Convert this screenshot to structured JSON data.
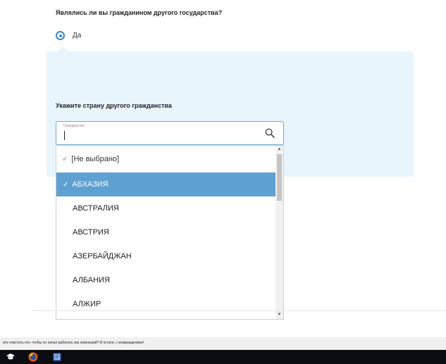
{
  "form": {
    "question": "Являлись ли вы гражданином другого государства?",
    "radio_option": "Да",
    "country_label": "Укажите страну другого гражданства",
    "input": {
      "caption": "Гражданство",
      "value": ""
    }
  },
  "dropdown": {
    "items": [
      {
        "label": "[Не выбрано]",
        "checked": true
      },
      {
        "label": "АБХАЗИЯ",
        "checked": true,
        "highlighted": true
      },
      {
        "label": "АВСТРАЛИЯ"
      },
      {
        "label": "АВСТРИЯ"
      },
      {
        "label": "АЗЕРБАЙДЖАН"
      },
      {
        "label": "АЛБАНИЯ"
      },
      {
        "label": "АЛЖИР"
      }
    ]
  },
  "notification": {
    "text": "ите очистить его, чтобы он начал работать как новенький? И кстати, с возвращением!"
  },
  "colors": {
    "accent": "#3a86c8",
    "panel_bg": "#e8f5fc",
    "selected_bg": "#5ea0d2",
    "taskbar_bg": "#0b0b12"
  },
  "icons": [
    "radio-selected-icon",
    "search-icon",
    "check-icon",
    "chevron-up-icon",
    "chevron-down-icon",
    "graduation-cap-icon",
    "firefox-icon",
    "document-app-icon"
  ]
}
